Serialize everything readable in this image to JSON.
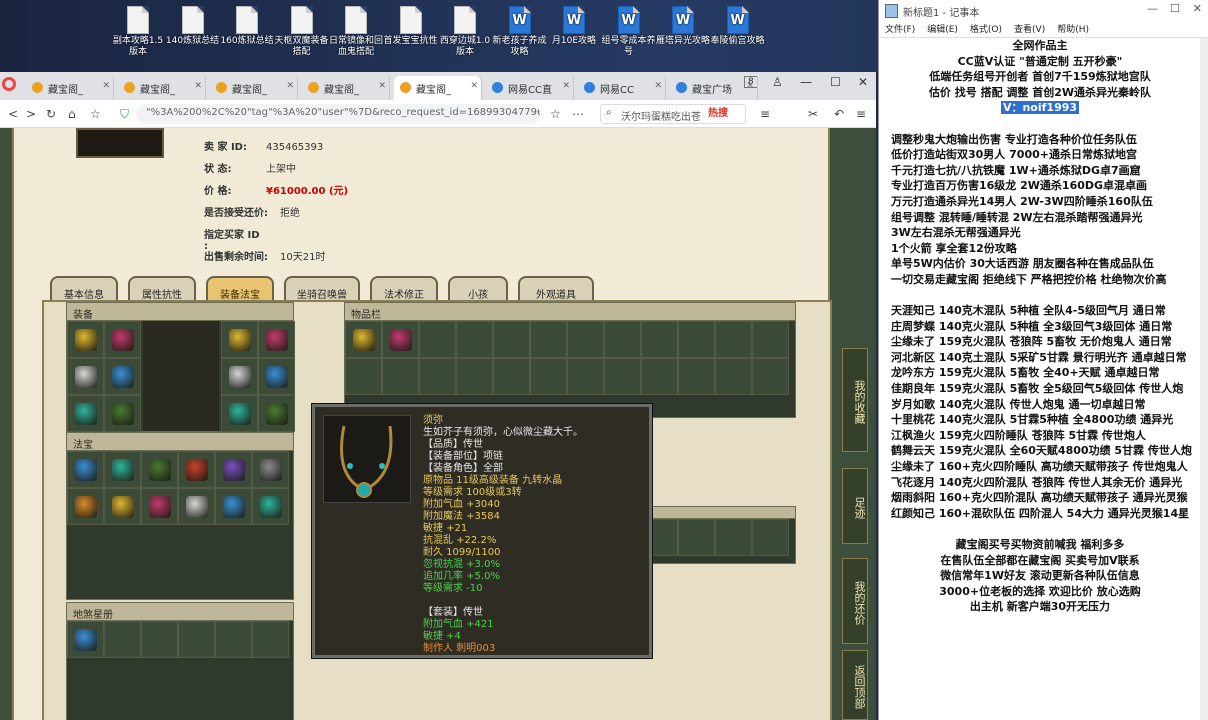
{
  "desktop": {
    "icons": [
      {
        "label": "副本攻略1.5版本",
        "type": "doc"
      },
      {
        "label": "140炼狱总结",
        "type": "doc"
      },
      {
        "label": "160炼狱总结",
        "type": "doc"
      },
      {
        "label": "天枢双魔装备搭配",
        "type": "doc"
      },
      {
        "label": "日常镜像和回血鬼搭配",
        "type": "doc"
      },
      {
        "label": "首发宝宝抗性",
        "type": "doc"
      },
      {
        "label": "西穿边城1.0版本",
        "type": "doc"
      },
      {
        "label": "新老孩子养成攻略",
        "type": "word"
      },
      {
        "label": "月10E攻略",
        "type": "word"
      },
      {
        "label": "组号零成本养号",
        "type": "word"
      },
      {
        "label": "雁塔异光攻略",
        "type": "word"
      },
      {
        "label": "奉陵偷宫攻略",
        "type": "word"
      }
    ]
  },
  "browser": {
    "tabs": [
      {
        "label": "藏宝阁_",
        "icon": "treasure-icon"
      },
      {
        "label": "藏宝阁_",
        "icon": "treasure-icon"
      },
      {
        "label": "藏宝阁_",
        "icon": "treasure-icon"
      },
      {
        "label": "藏宝阁_",
        "icon": "treasure-icon"
      },
      {
        "label": "藏宝阁_",
        "icon": "treasure-icon"
      },
      {
        "label": "网易CC直",
        "icon": "cc-icon"
      },
      {
        "label": "网易CC",
        "icon": "cc-icon"
      },
      {
        "label": "藏宝广场",
        "icon": "globe-icon"
      }
    ],
    "tab_count": "8",
    "url": "\"%3A%200%2C%20\"tag\"%3A%20\"user\"%7D&reco_request_id=1689930477964ssxCj",
    "search_text": "沃尔玛蛋糕吃出苍",
    "hot_label": "热搜"
  },
  "listing": {
    "seller_label": "卖 家  ID:",
    "seller_id": "435465393",
    "status_label": "状    态:",
    "status": "上架中",
    "price_label": "价    格:",
    "price": "¥61000.00 (元)",
    "bargain_label": "是否接受还价:",
    "bargain": "拒绝",
    "buyer_label": "指定买家 ID :",
    "buyer": "",
    "remaining_label": "出售剩余时间:",
    "remaining": "10天21时"
  },
  "panel_tabs": [
    "基本信息",
    "属性抗性",
    "装备法宝",
    "坐骑召唤兽",
    "法术修正",
    "小孩",
    "外观道具"
  ],
  "sections": {
    "equipment": "装备",
    "fabao": "法宝",
    "inventory": "物品栏",
    "extra": "地煞星册"
  },
  "tooltip": {
    "name": "须弥",
    "desc": "生如芥子有须弥，心似微尘藏大千。",
    "lines": [
      {
        "text": "【品质】传世",
        "color": "w"
      },
      {
        "text": "【装备部位】项链",
        "color": "w"
      },
      {
        "text": "【装备角色】全部",
        "color": "w"
      },
      {
        "text": "原物品 11级高级装备 九转水晶",
        "color": "y"
      },
      {
        "text": "等级需求 100级或3转",
        "color": "y"
      },
      {
        "text": "附加气血 +3040",
        "color": "y"
      },
      {
        "text": "附加魔法 +3584",
        "color": "y"
      },
      {
        "text": "敏捷 +21",
        "color": "y"
      },
      {
        "text": "抗混乱 +22.2%",
        "color": "y"
      },
      {
        "text": "耐久 1099/1100",
        "color": "y"
      },
      {
        "text": "忽视抗混 +3.0%",
        "color": "g"
      },
      {
        "text": "追加几率 +5.0%",
        "color": "g"
      },
      {
        "text": "等级需求 -10",
        "color": "g"
      },
      {
        "text": "",
        "color": "w"
      },
      {
        "text": "【套装】传世",
        "color": "w"
      },
      {
        "text": "附加气血 +421",
        "color": "g"
      },
      {
        "text": "敏捷 +4",
        "color": "g"
      },
      {
        "text": "制作人 刺明003",
        "color": "o"
      }
    ]
  },
  "side_buttons": [
    "我的收藏",
    "足迹",
    "我的还价",
    "返回顶部"
  ],
  "notepad": {
    "title": "新标题1 - 记事本",
    "menu": [
      "文件(F)",
      "编辑(E)",
      "格式(O)",
      "查看(V)",
      "帮助(H)"
    ],
    "lines": [
      {
        "text": "全网作品主",
        "align": "c"
      },
      {
        "text": "CC蓝V认证 \"普通定制 五开秒豪\"",
        "align": "c"
      },
      {
        "text": "低端任务组号开创者        首创7千159炼狱地宫队",
        "align": "c"
      },
      {
        "text": "估价 找号 搭配 调整        首创2W通杀异光秦岭队",
        "align": "c"
      },
      {
        "text": "V：noif1993",
        "align": "c",
        "hl": true
      },
      {
        "text": "",
        "align": "l"
      },
      {
        "text": "调整秒鬼大炮输出伤害        专业打造各种价位任务队伍",
        "align": "l"
      },
      {
        "text": "低价打造站街双30男人          7000+通杀日常炼狱地宫",
        "align": "l"
      },
      {
        "text": "千元打造七抗/八抗铁魔        1W+通杀炼狱DG卓7画窟",
        "align": "l"
      },
      {
        "text": "专业打造百万伤害16级龙         2W通杀160DG卓混卓画",
        "align": "l"
      },
      {
        "text": "万元打造通杀异光14男人       2W-3W四阶睡杀160队伍",
        "align": "l"
      },
      {
        "text": "组号调整 混转睡/睡转混          2W左右混杀踏帮强通异光",
        "align": "l"
      },
      {
        "text": "                                  3W左右混杀无帮强通异光",
        "align": "l"
      },
      {
        "text": "1个火箭 享全套12份攻略",
        "align": "l"
      },
      {
        "text": "单号5W内估价 30大话西游        朋友圈各种在售成品队伍",
        "align": "l"
      },
      {
        "text": "一切交易走藏宝阁 拒绝线下     严格把控价格 杜绝物次价高",
        "align": "l"
      },
      {
        "text": "",
        "align": "l"
      },
      {
        "text": "天涯知己 140克木混队 5种植 全队4-5级回气月 通日常",
        "align": "l"
      },
      {
        "text": "庄周梦蝶 140克火混队 5种植 全3级回气3级回体 通日常",
        "align": "l"
      },
      {
        "text": "尘缘未了 159克火混队 苍狼阵 5畜牧 无价炮鬼人 通日常",
        "align": "l"
      },
      {
        "text": "河北新区 140克土混队 5采矿5甘霖 景行明光齐 通卓越日常",
        "align": "l"
      },
      {
        "text": "龙吟东方 159克火混队 5畜牧 全40+天赋 通卓越日常",
        "align": "l"
      },
      {
        "text": "佳期良年 159克火混队 5畜牧 全5级回气5级回体 传世人炮",
        "align": "l"
      },
      {
        "text": "岁月如歌 140克火混队 传世人炮鬼 通一切卓越日常",
        "align": "l"
      },
      {
        "text": "十里桃花 140克火混队 5甘霖5种植 全4800功绩 通异光",
        "align": "l"
      },
      {
        "text": "江枫渔火 159克火四阶睡队 苍狼阵 5甘霖 传世炮人",
        "align": "l"
      },
      {
        "text": "鹤舞云天 159克火混队 全60天赋4800功绩 5甘霖 传世人炮",
        "align": "l"
      },
      {
        "text": "尘缘未了 160+克火四阶睡队 高功绩天赋带孩子 传世炮鬼人",
        "align": "l"
      },
      {
        "text": "飞花逐月 140克火四阶混队 苍狼阵 传世人其余无价 通异光",
        "align": "l"
      },
      {
        "text": "烟雨斜阳 160+克火四阶混队 高功绩天赋带孩子 通异光灵猴",
        "align": "l"
      },
      {
        "text": "红颜知己 160+混砍队伍 四阶混人 54大力 通异光灵猴14星",
        "align": "l"
      },
      {
        "text": "",
        "align": "l"
      },
      {
        "text": "藏宝阁买号买物资前喊我 福利多多",
        "align": "c"
      },
      {
        "text": "在售队伍全部都在藏宝阁 买卖号加V联系",
        "align": "c"
      },
      {
        "text": "微信常年1W好友 滚动更新各种队伍信息",
        "align": "c"
      },
      {
        "text": "3000+位老板的选择 欢迎比价 放心选购",
        "align": "c"
      },
      {
        "text": "出主机 新客户端30开无压力",
        "align": "c"
      }
    ]
  },
  "colors": {
    "paper": "#f0ead6",
    "price": "#cc0000",
    "tooltip_bg": "#2f2c24",
    "tooltip_yellow": "#e8c95a",
    "tooltip_green": "#4ad34a",
    "highlight": "#2f6fce"
  }
}
